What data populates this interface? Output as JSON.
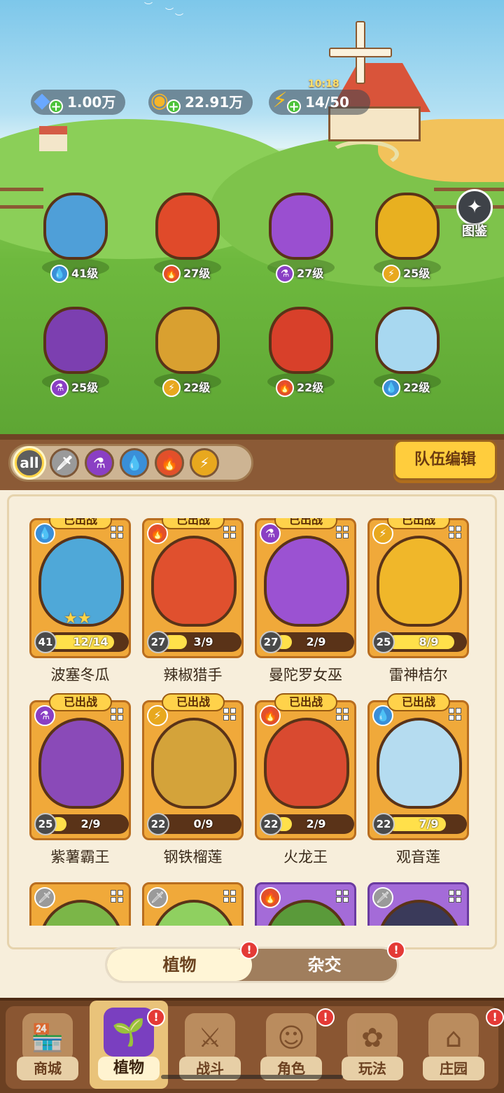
{
  "resources": {
    "gems": "1.00万",
    "coins": "22.91万",
    "energy": "14/50",
    "energy_timer": "10:18"
  },
  "gallery_label": "图鉴",
  "field_plants": [
    {
      "level": "41级",
      "element": "water",
      "color": "#4f9fd8"
    },
    {
      "level": "27级",
      "element": "fire",
      "color": "#e04a2a"
    },
    {
      "level": "27级",
      "element": "magic",
      "color": "#9a4fd0"
    },
    {
      "level": "25级",
      "element": "thunder",
      "color": "#e8b020"
    },
    {
      "level": "25级",
      "element": "magic",
      "color": "#7c3fb0"
    },
    {
      "level": "22级",
      "element": "thunder",
      "color": "#d9a030"
    },
    {
      "level": "22级",
      "element": "fire",
      "color": "#d8402a"
    },
    {
      "level": "22级",
      "element": "water",
      "color": "#a8d8f0"
    }
  ],
  "filters": {
    "all_label": "all",
    "items": [
      "all-filter",
      "sword-filter",
      "potion-filter",
      "water-filter",
      "fire-filter",
      "thunder-filter"
    ]
  },
  "team_edit_label": "队伍编辑",
  "deployed_label": "已出战",
  "cards": [
    {
      "name": "波塞冬瓜",
      "level": "41",
      "fragments": "12/14",
      "progress": 0.86,
      "element": "water",
      "color": "#4fa8d8",
      "stars": "★★"
    },
    {
      "name": "辣椒猎手",
      "level": "27",
      "fragments": "3/9",
      "progress": 0.33,
      "element": "fire",
      "color": "#e0502e",
      "stars": ""
    },
    {
      "name": "曼陀罗女巫",
      "level": "27",
      "fragments": "2/9",
      "progress": 0.22,
      "element": "magic",
      "color": "#9b52d2",
      "stars": ""
    },
    {
      "name": "雷神桔尔",
      "level": "25",
      "fragments": "8/9",
      "progress": 0.89,
      "element": "thunder",
      "color": "#f0b72a",
      "stars": ""
    },
    {
      "name": "紫薯霸王",
      "level": "25",
      "fragments": "2/9",
      "progress": 0.22,
      "element": "magic",
      "color": "#8a4ab8",
      "stars": ""
    },
    {
      "name": "钢铁榴莲",
      "level": "22",
      "fragments": "0/9",
      "progress": 0.0,
      "element": "thunder",
      "color": "#d4a33a",
      "stars": ""
    },
    {
      "name": "火龙王",
      "level": "22",
      "fragments": "2/9",
      "progress": 0.22,
      "element": "fire",
      "color": "#d94a30",
      "stars": ""
    },
    {
      "name": "观音莲",
      "level": "22",
      "fragments": "7/9",
      "progress": 0.78,
      "element": "water",
      "color": "#b5dcf0",
      "stars": ""
    }
  ],
  "partial_cards": [
    {
      "element": "sword",
      "color": "#7bb648",
      "frame": "orange"
    },
    {
      "element": "sword",
      "color": "#8fd060",
      "frame": "orange"
    },
    {
      "element": "fire",
      "color": "#5a9a3a",
      "frame": "purple"
    },
    {
      "element": "sword",
      "color": "#3a3a5a",
      "frame": "purple"
    }
  ],
  "toggle": {
    "plants": "植物",
    "hybrid": "杂交"
  },
  "nav": [
    {
      "label": "商城",
      "icon": "shop-icon"
    },
    {
      "label": "植物",
      "icon": "plants-icon",
      "active": true
    },
    {
      "label": "战斗",
      "icon": "battle-icon"
    },
    {
      "label": "角色",
      "icon": "character-icon"
    },
    {
      "label": "玩法",
      "icon": "gameplay-icon"
    },
    {
      "label": "庄园",
      "icon": "manor-icon"
    }
  ],
  "alert_mark": "!"
}
